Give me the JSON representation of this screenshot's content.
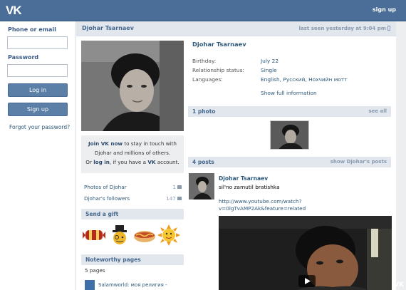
{
  "topbar": {
    "logo": "VK",
    "signup": "sign up"
  },
  "login": {
    "phone_label": "Phone or email",
    "password_label": "Password",
    "login_button": "Log in",
    "signup_button": "Sign up",
    "forgot": "Forgot your password?"
  },
  "header": {
    "name": "Djohar Tsarnaev",
    "last_seen": "last seen yesterday at 9:04 pm"
  },
  "join": {
    "line1_bold": "Join VK now",
    "line1_rest": " to stay in touch with",
    "line2": "Djohar and millions of others.",
    "line3_a": "Or ",
    "line3_bold": "log in",
    "line3_b": ", if you have a ",
    "line3_vk": "VK",
    "line3_c": " account."
  },
  "counters": [
    {
      "label": "Photos of Djohar",
      "count": "1"
    },
    {
      "label": "Djohar's followers",
      "count": "147"
    }
  ],
  "sections": {
    "gift": "Send a gift",
    "noteworthy": "Noteworthy pages",
    "photos": "1 photo",
    "see_all": "see all",
    "posts": "4 posts",
    "show_posts": "show Djohar's posts"
  },
  "noteworthy": {
    "count_text": "5 pages",
    "item": "Salamworld: моя религия -"
  },
  "profile": {
    "name": "Djohar Tsarnaev",
    "info": [
      {
        "key": "Birthday:",
        "value": "July 22"
      },
      {
        "key": "Relationship status:",
        "value": "Single"
      },
      {
        "key": "Languages:",
        "value": "English, Русский, Нохчийн мотт"
      }
    ],
    "show_full": "Show full information"
  },
  "post": {
    "author": "Djohar Tsarnaev",
    "text": "sil'no zamutil bratishka",
    "link_line1": "http://www.youtube.com/watch?",
    "link_line2": "v=0lgTvAMP2Ak&feature=related"
  },
  "watermark": "VK",
  "colors": {
    "topbar": "#4a6e97",
    "accent": "#45688e",
    "link": "#2b587a",
    "section_bg": "#e2e7ee"
  }
}
